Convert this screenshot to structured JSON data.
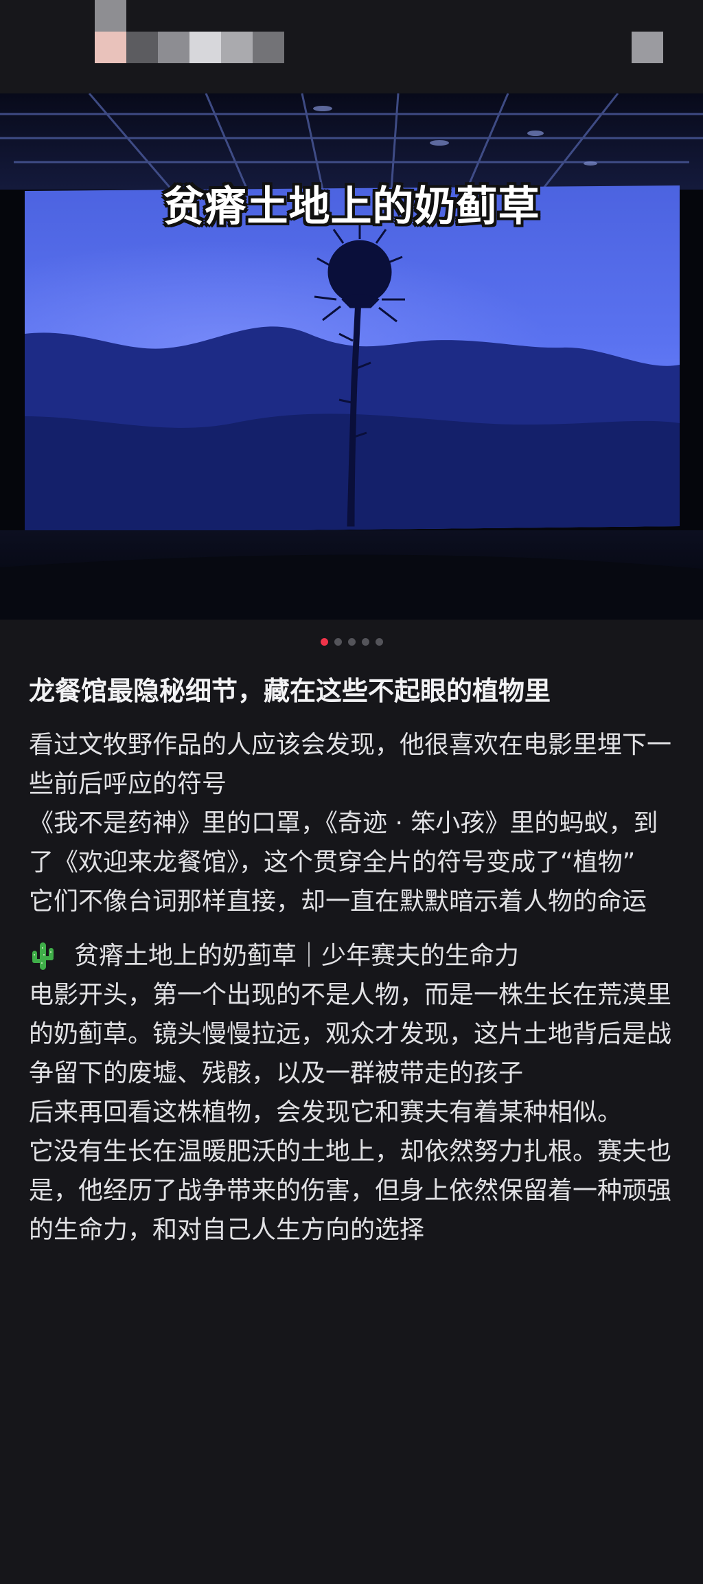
{
  "image": {
    "caption": "贫瘠土地上的奶蓟草",
    "carousel": {
      "count": 5,
      "active": 0
    }
  },
  "post": {
    "title": "龙餐馆最隐秘细节，藏在这些不起眼的植物里",
    "intro": [
      "看过文牧野作品的人应该会发现，他很喜欢在电影里埋下一些前后呼应的符号",
      "《我不是药神》里的口罩，《奇迹 · 笨小孩》里的蚂蚁，到了《欢迎来龙餐馆》，这个贯穿全片的符号变成了“植物”",
      "它们不像台词那样直接，却一直在默默暗示着人物的命运"
    ],
    "section1": {
      "icon": "cactus-icon",
      "heading": "贫瘠土地上的奶蓟草｜少年赛夫的生命力",
      "paragraphs": [
        "电影开头，第一个出现的不是人物，而是一株生长在荒漠里的奶蓟草。镜头慢慢拉远，观众才发现，这片土地背后是战争留下的废墟、残骸，以及一群被带走的孩子",
        "后来再回看这株植物，会发现它和赛夫有着某种相似。",
        "它没有生长在温暖肥沃的土地上，却依然努力扎根。赛夫也是，他经历了战争带来的伤害，但身上依然保留着一种顽强的生命力，和对自己人生方向的选择"
      ]
    }
  },
  "colors": {
    "background": "#16161a",
    "text": "#e1e1e4",
    "active_dot": "#f0344a",
    "inactive_dot": "#54545a"
  }
}
